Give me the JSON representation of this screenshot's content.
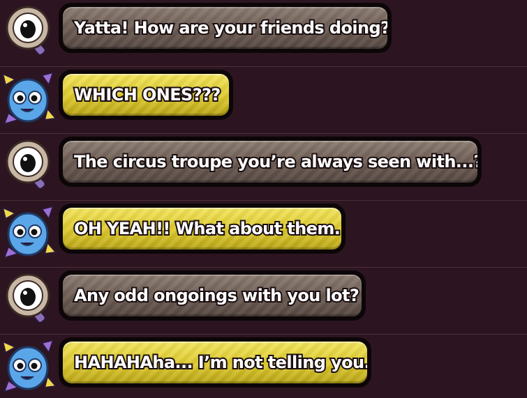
{
  "colors": {
    "background": "#2c1520",
    "divider": "#4a3038",
    "bubble_outline": "#0c0608",
    "gray_bubble": "#7a6a60",
    "yellow_bubble": "#e0cc30",
    "text": "#ffffff",
    "text_outline": "#1a0e10"
  },
  "messages": [
    {
      "speaker": "eyeball-character",
      "style": "gray",
      "text": "Yatta! How are your friends doing?"
    },
    {
      "speaker": "blue-horned-character",
      "style": "yellow",
      "text": "WHICH ONES???"
    },
    {
      "speaker": "eyeball-character",
      "style": "gray",
      "text": "The circus troupe you’re always seen with...?"
    },
    {
      "speaker": "blue-horned-character",
      "style": "yellow",
      "text": "OH YEAH!! What about them."
    },
    {
      "speaker": "eyeball-character",
      "style": "gray",
      "text": "Any odd ongoings with you lot?"
    },
    {
      "speaker": "blue-horned-character",
      "style": "yellow",
      "text": "HAHAHAha... I’m not telling you."
    }
  ]
}
